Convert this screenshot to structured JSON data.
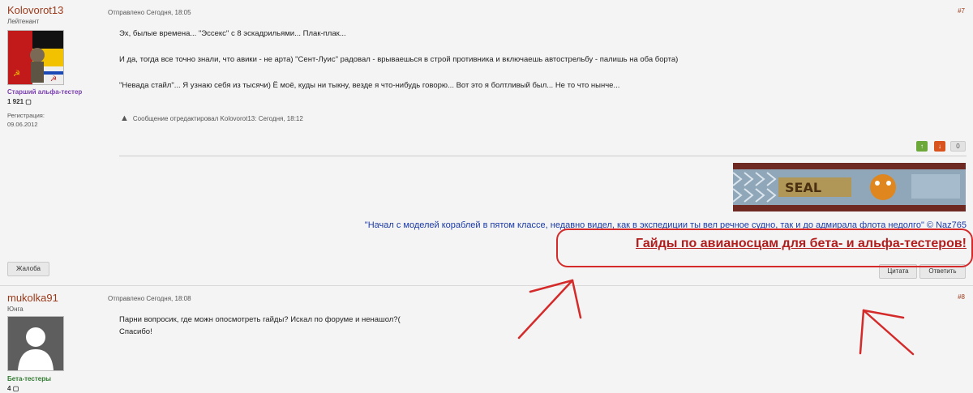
{
  "posts": [
    {
      "username": "Kolovorot13",
      "rank": "Лейтенант",
      "group": "Старший альфа-тестер",
      "count": "1 921",
      "reg_label": "Регистрация:",
      "reg_date": "09.06.2012",
      "meta": "Отправлено Сегодня, 18:05",
      "number": "#7",
      "lines": [
        "Эх, былые времена... \"Эссекс\" с 8 эскадрильями... Плак-плак...",
        "И да, тогда все точно знали, что авики - не арта) \"Сент-Луис\" радовал - врываешься в строй противника и включаешь автострельбу - палишь на оба борта)",
        "\"Невада стайл\"... Я узнаю себя из тысячи) Ё моё, куды ни тыкну, везде я что-нибудь говорю... Вот это я болтливый был... Не то что нынче..."
      ],
      "edited": "Сообщение отредактировал Kolovorot13: Сегодня, 18:12",
      "vote_count": "0",
      "banner_text": "SEAL",
      "signature_quote": "\"Начал с моделей кораблей в пятом классе, недавно видел, как в экспедиции ты вел речное судно, так и до адмирала флота недолго\" © Naz765",
      "signature_link": "Гайды по авианосцам для бета- и альфа-тестеров!",
      "report": "Жалоба",
      "quote_btn": "Цитата",
      "reply_btn": "Ответить"
    },
    {
      "username": "mukolka91",
      "rank": "Юнга",
      "group": "Бета-тестеры",
      "count": "4",
      "meta": "Отправлено Сегодня, 18:08",
      "number": "#8",
      "lines": [
        "Парни вопросик, где можн опосмотреть гайды? Искал по форуме и ненашол?(",
        "Спасибо!"
      ]
    }
  ],
  "colors": {
    "username": "#9b3a1a",
    "annotation": "#d42a2a",
    "quote": "#1a3aa8",
    "group1": "#7a3fb0",
    "group2": "#2f7a2f"
  }
}
